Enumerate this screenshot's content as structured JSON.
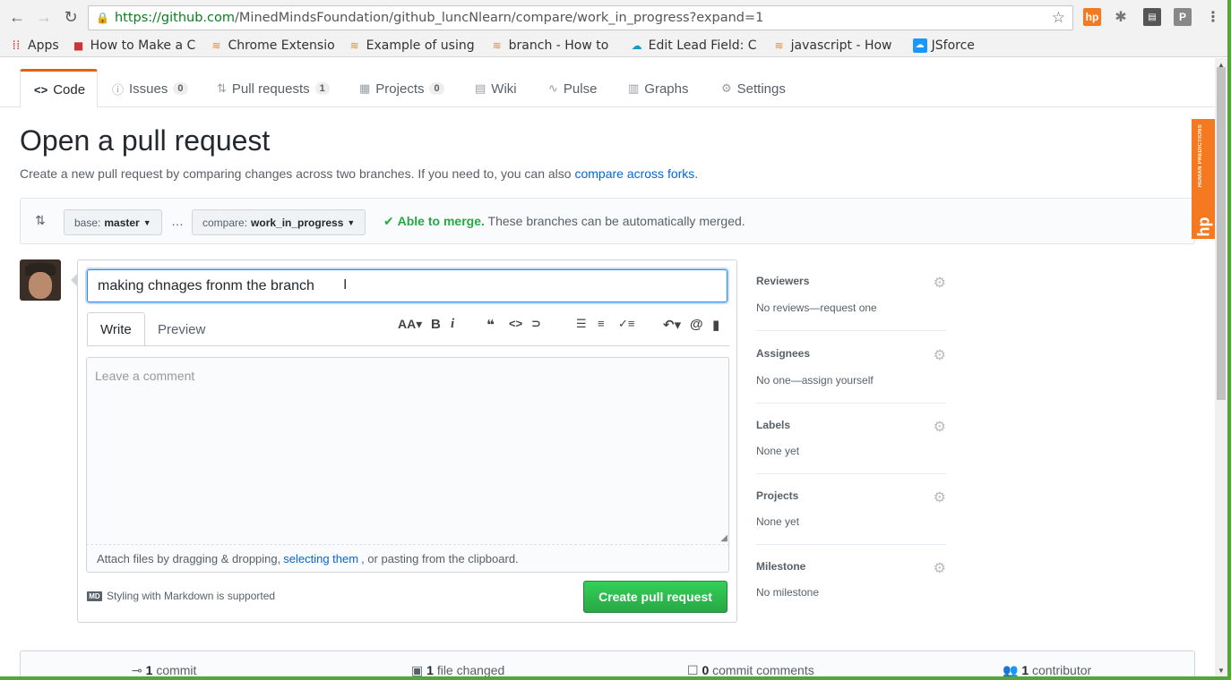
{
  "browser": {
    "url_host": "https://github.com",
    "url_path": "/MinedMindsFoundation/github_luncNlearn/compare/work_in_progress?expand=1",
    "ext_hp": "hp",
    "ext_p": "P",
    "bookmarks": [
      {
        "label": "Apps",
        "icon": "apps-grid-icon"
      },
      {
        "label": "How to Make a C",
        "icon": "bookmark-icon"
      },
      {
        "label": "Chrome Extensio",
        "icon": "stackoverflow-icon"
      },
      {
        "label": "Example of using",
        "icon": "stackoverflow-icon"
      },
      {
        "label": "branch - How to",
        "icon": "stackoverflow-icon"
      },
      {
        "label": "Edit Lead Field: C",
        "icon": "salesforce-cloud-icon"
      },
      {
        "label": "javascript - How",
        "icon": "stackoverflow-icon"
      },
      {
        "label": "JSforce",
        "icon": "jsforce-icon"
      }
    ]
  },
  "repo_nav": {
    "tabs": [
      {
        "label": "Code",
        "icon": "<>",
        "count": null
      },
      {
        "label": "Issues",
        "icon": "ⓘ",
        "count": "0"
      },
      {
        "label": "Pull requests",
        "icon": "⇅",
        "count": "1"
      },
      {
        "label": "Projects",
        "icon": "▦",
        "count": "0"
      },
      {
        "label": "Wiki",
        "icon": "▤",
        "count": null
      },
      {
        "label": "Pulse",
        "icon": "∿",
        "count": null
      },
      {
        "label": "Graphs",
        "icon": "▥",
        "count": null
      },
      {
        "label": "Settings",
        "icon": "⚙",
        "count": null
      }
    ]
  },
  "page": {
    "title": "Open a pull request",
    "subtitle_text": "Create a new pull request by comparing changes across two branches. If you need to, you can also",
    "subtitle_link": "compare across forks",
    "subtitle_end": "."
  },
  "range": {
    "base_label": "base:",
    "base_value": "master",
    "dots": "…",
    "compare_label": "compare:",
    "compare_value": "work_in_progress",
    "merge_ok": "Able to merge.",
    "merge_text": "These branches can be automatically merged."
  },
  "composer": {
    "title_value": "making chnages fronm the branch",
    "tab_write": "Write",
    "tab_preview": "Preview",
    "comment_placeholder": "Leave a comment",
    "attach_pre": "Attach files by dragging & dropping,",
    "attach_link": "selecting them",
    "attach_post": ", or pasting from the clipboard.",
    "markdown_icon": "MD",
    "markdown_note": "Styling with Markdown is supported",
    "submit_label": "Create pull request"
  },
  "sidebar": [
    {
      "title": "Reviewers",
      "value": "No reviews—request one"
    },
    {
      "title": "Assignees",
      "value": "No one—assign yourself"
    },
    {
      "title": "Labels",
      "value": "None yet"
    },
    {
      "title": "Projects",
      "value": "None yet"
    },
    {
      "title": "Milestone",
      "value": "No milestone"
    }
  ],
  "hp_widget": {
    "text": "HUMAN PREDICTIONS",
    "logo": "hp"
  },
  "stats": {
    "commits": {
      "count": "1",
      "label": "commit"
    },
    "files": {
      "count": "1",
      "label": "file changed"
    },
    "comments": {
      "count": "0",
      "label": "commit comments"
    },
    "contributors": {
      "count": "1",
      "label": "contributor"
    }
  },
  "colors": {
    "accent_orange": "#e36209",
    "merge_green": "#28a745",
    "link_blue": "#0366d6"
  }
}
